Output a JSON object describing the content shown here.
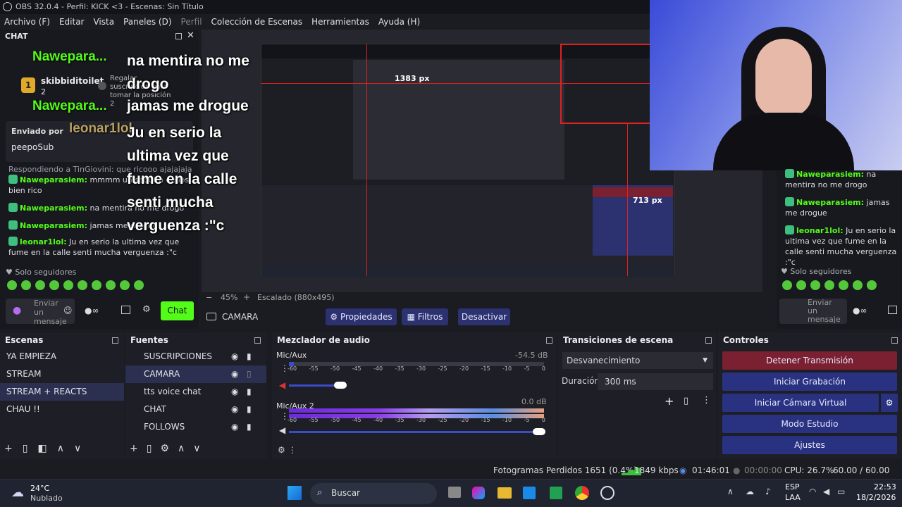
{
  "window_title": "OBS 32.0.4 - Perfil: KICK <3 - Escenas: Sin Título",
  "menu": [
    "Archivo (F)",
    "Editar",
    "Vista",
    "Paneles (D)",
    "Perfil",
    "Colección de Escenas",
    "Herramientas",
    "Ayuda (H)"
  ],
  "chat": {
    "title": "CHAT",
    "top_user": "Nawepara...",
    "gift_user": "skibbiditoilet",
    "gift_count": "2",
    "gift_text": "Regalar suscripción para tomar la posición 2",
    "second_user": "Nawepara...",
    "third_user": "leonar1lol",
    "pinned_label": "Enviado por",
    "pinned_text": "peepoSub",
    "reply_to": "Respondiendo a TinGiovini: que ricooo ajajajaja",
    "messages": [
      {
        "user": "Naweparasiem:",
        "text": "mmmm un saquito de los bien rico"
      },
      {
        "user": "Naweparasiem:",
        "text": "na mentira no me drogo"
      },
      {
        "user": "Naweparasiem:",
        "text": "jamas me drogue"
      },
      {
        "user": "leonar1lol:",
        "text": "Ju en serio la ultima vez que fume en la calle senti mucha verguenza :\"c"
      }
    ],
    "followers_only": "Solo seguidores",
    "input_placeholder": "Enviar un mensaje",
    "send_label": "Chat"
  },
  "overlay_lines": [
    "na mentira no me drogo",
    "jamas me drogue",
    "Ju en serio la ultima vez que fume en la calle senti mucha verguenza :\"c"
  ],
  "preview": {
    "zoom": "45%",
    "scale": "Escalado (880x495)",
    "dim_w": "1383 px",
    "dim_h": "713 px"
  },
  "source_toolbar": {
    "source": "CAMARA",
    "properties": "Propiedades",
    "filters": "Filtros",
    "deactivate": "Desactivar"
  },
  "right_chat": {
    "messages": [
      {
        "user": "Naweparasiem:",
        "text": "na mentira no me drogo"
      },
      {
        "user": "Naweparasiem:",
        "text": "jamas me drogue"
      },
      {
        "user": "leonar1lol:",
        "text": "Ju en serio la ultima vez que fume en la calle senti mucha verguenza :\"c"
      }
    ],
    "followers_only": "Solo seguidores",
    "input_placeholder": "Enviar un mensaje"
  },
  "scenes": {
    "title": "Escenas",
    "items": [
      "YA EMPIEZA",
      "STREAM",
      "STREAM + REACTS",
      "CHAU !!"
    ],
    "selected": "STREAM + REACTS"
  },
  "sources": {
    "title": "Fuentes",
    "items": [
      "SUSCRIPCIONES",
      "CAMARA",
      "tts voice chat",
      "CHAT",
      "FOLLOWS"
    ]
  },
  "mixer": {
    "title": "Mezclador de audio",
    "tracks": [
      {
        "name": "Mic/Aux",
        "db": "-54.5 dB",
        "level": 0.03
      },
      {
        "name": "Mic/Aux 2",
        "db": "0.0 dB",
        "level": 1.0
      }
    ],
    "ticks": [
      "-60",
      "-55",
      "-50",
      "-45",
      "-40",
      "-35",
      "-30",
      "-25",
      "-20",
      "-15",
      "-10",
      "-5",
      "0"
    ]
  },
  "transitions": {
    "title": "Transiciones de escena",
    "selected": "Desvanecimiento",
    "duration_label": "Duración",
    "duration_value": "300 ms"
  },
  "controls": {
    "title": "Controles",
    "stop_stream": "Detener Transmisión",
    "start_recording": "Iniciar Grabación",
    "virtual_cam": "Iniciar Cámara Virtual",
    "studio_mode": "Modo Estudio",
    "settings": "Ajustes"
  },
  "status": {
    "dropped": "Fotogramas Perdidos 1651 (0.4%)",
    "kbps": "1849 kbps",
    "live_time": "01:46:01",
    "rec_time": "00:00:00",
    "cpu": "CPU: 26.7%",
    "fps": "60.00 / 60.00 FPS"
  },
  "taskbar": {
    "temp": "24°C",
    "weather": "Nublado",
    "search": "Buscar",
    "lang1": "ESP",
    "lang2": "LAA",
    "time": "22:53",
    "date": "18/2/2026"
  },
  "colors": {
    "kick_green": "#53fc18",
    "stop_red": "#7a2030",
    "control_blue": "#283280"
  }
}
